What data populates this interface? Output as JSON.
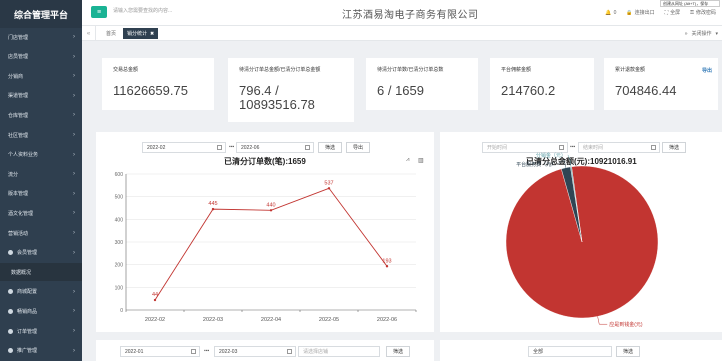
{
  "sidebar": {
    "title": "综合管理平台",
    "items": [
      {
        "label": "门店管理",
        "arrow": true
      },
      {
        "label": "店员管理",
        "arrow": true
      },
      {
        "label": "分销商",
        "arrow": true
      },
      {
        "label": "渠道管理",
        "arrow": true
      },
      {
        "label": "仓库管理",
        "arrow": true
      },
      {
        "label": "社区管理",
        "arrow": true
      },
      {
        "label": "个人资料业务",
        "arrow": true
      },
      {
        "label": "流分",
        "arrow": true
      },
      {
        "label": "版本管理",
        "arrow": true
      },
      {
        "label": "酒文化管理",
        "arrow": true
      },
      {
        "label": "营销活动",
        "arrow": true
      },
      {
        "label": "会员管理",
        "arrow": true,
        "icon": true
      },
      {
        "label": "数据概况",
        "arrow": false,
        "sub": true
      },
      {
        "label": "商城配置",
        "arrow": true,
        "icon": true
      },
      {
        "label": "畅销商品",
        "arrow": true,
        "icon": true
      },
      {
        "label": "订单管理",
        "arrow": true,
        "icon": true
      },
      {
        "label": "推广管理",
        "arrow": true,
        "icon": true
      }
    ]
  },
  "header": {
    "menu_icon": "menu-icon",
    "search_placeholder": "请输入您需要查找的内容...",
    "company": "江苏酒易淘电子商务有限公司",
    "tools": [
      {
        "icon": "bell-icon",
        "label": "0"
      },
      {
        "icon": "lock-icon",
        "label": "连接出口"
      },
      {
        "icon": "fullscreen-icon",
        "label": "全屏"
      },
      {
        "icon": "key-icon",
        "label": "修改密码"
      }
    ],
    "tooltip": "创建从网址 (Alt+T)，保存"
  },
  "tabs": {
    "home": "首页",
    "active": "销分统计",
    "close_ops": "关闭操作"
  },
  "stats": [
    {
      "title": "交易总金额",
      "value": "11626659.75"
    },
    {
      "title": "待清分订单总金额/已清分订单总金额",
      "value": "796.4 / 10893516.78"
    },
    {
      "title": "待清分订单数/已清分订单总数",
      "value": "6 / 1659"
    },
    {
      "title": "平台佣薪金额",
      "value": "214760.2"
    },
    {
      "title": "累计退款金额",
      "value": "704846.44",
      "action": "导出"
    }
  ],
  "left_panel": {
    "start_date": "2022-02",
    "end_date": "2022-06",
    "filter_label": "筛选",
    "export_label": "导出",
    "tool_icons": [
      "line-chart-icon",
      "bar-chart-icon"
    ]
  },
  "right_panel": {
    "start_placeholder": "开始时间",
    "end_placeholder": "结束时间",
    "filter_label": "筛选"
  },
  "bottom_left": {
    "start_date": "2022-01",
    "end_date": "2022-03",
    "placeholder": "请选择店铺",
    "filter_label": "筛选"
  },
  "bottom_right": {
    "select_value": "全部",
    "filter_label": "筛选"
  },
  "chart_data": [
    {
      "type": "line",
      "title": "已清分订单数(笔):1659",
      "categories": [
        "2022-02",
        "2022-03",
        "2022-04",
        "2022-05",
        "2022-06"
      ],
      "series": [
        {
          "values": [
            44,
            445,
            440,
            537,
            193
          ]
        }
      ],
      "ylim": [
        0,
        600
      ],
      "yticks": [
        0,
        100,
        200,
        300,
        400,
        500,
        600
      ],
      "grid": true,
      "color": "#c23531"
    },
    {
      "type": "pie",
      "title": "已清分总金额(元):10921016.91",
      "slices": [
        {
          "label": "应是到钱金(元)",
          "value": 10681432.5,
          "color": "#c23531"
        },
        {
          "label": "平台服务费（元）",
          "value": 214760.2,
          "color": "#2f4554"
        },
        {
          "label": "分销金（元）",
          "value": 24824.2,
          "color": "#61a0a8"
        }
      ]
    }
  ]
}
